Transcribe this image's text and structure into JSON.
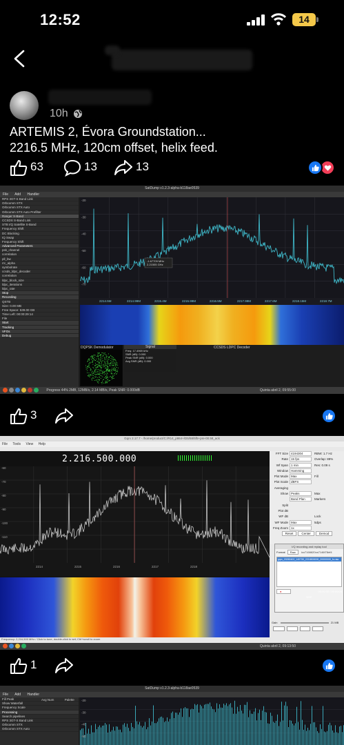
{
  "status_bar": {
    "time": "12:52",
    "battery": "14"
  },
  "post": {
    "time": "10h",
    "caption_line1": "ARTEMIS 2, Évora Groundstation...",
    "caption_line2": "2216.5 MHz, 120cm offset, helix feed.",
    "likes": "63",
    "comments": "13",
    "shares": "13"
  },
  "screenshot1": {
    "window_title": "SatDump v1.2.3-alpha-b118ae0539",
    "menu": [
      "File",
      "Add",
      "Handler"
    ],
    "sidebar": [
      "RPS 3GT-S Band Link",
      "Orbcomm STX",
      "Orbcomm STX Auto",
      "Orbcomm STX Auto Prefilter",
      "Ranger X-Band",
      "CCSDS S-Band Link",
      "STB I/Q Satellite S-Band",
      "Frequency Shift",
      "DC Blocking",
      "IQ Swap",
      "Frequency Shift",
      "Advanced Parameters",
      "psk_channel",
      "correlation",
      "pll_bw",
      "rrc_alpha",
      "symbolrate",
      "ccsds_ldpc_decoder",
      "correlation",
      "ldpc_block_size",
      "ldpc_iterations",
      "ldpc_rate",
      "Stop",
      "Recording",
      "QSTB",
      "Size: 0.00 MB",
      "Free Space: 539.00 GB",
      "Time Left: 00:00:29:14",
      "File",
      "Start",
      "Tracking",
      "VFOs",
      "Debug"
    ],
    "freq_ticks": [
      "2214.5M",
      "2214.99M",
      "2215.4M",
      "2215.99M",
      "2216.5M",
      "2217.99M",
      "2217.6M",
      "2218.15M",
      "2218.7M"
    ],
    "y_ticks": [
      "-20",
      "-30",
      "-40",
      "-50",
      "-60",
      "-70"
    ],
    "marker": "-1.67709 MHz\n2.21505 GHz",
    "demod_title": "DQPSK Demodulator",
    "signal_title": "Signal",
    "signal_freq": "Freq: 17.4969 kHz",
    "snr": "SNR (dB): 0.000",
    "peak_snr": "Peak SNR (dB): 0.000",
    "avg_snr": "Avg SNR (dB): 0.000",
    "decoder_title": "CCSDS LDPC Decoder",
    "taskbar_text": "Progress 44% 2MB, 12MB/s, 2.14 MB/s, Peak SNR: 0.000dB",
    "clock": "Quinta abril 2, 09:55:00"
  },
  "post1_actions": {
    "likes": "3"
  },
  "screenshot2": {
    "window_title": "Gqrx 2.17.7 - /home/product/C:/R14_p864+/D5/58/5f5+pre-00.58_ack",
    "menu": [
      "File",
      "Tools",
      "View",
      "Help"
    ],
    "frequency_display": "2.216.500.000",
    "y_ticks": [
      "-60",
      "-70",
      "-80",
      "-90",
      "-100",
      "-110",
      "-120"
    ],
    "freq_ticks": [
      "2214",
      "2215",
      "2216",
      "2217",
      "2218"
    ],
    "fft_panel": {
      "rows": [
        [
          "FFT Size",
          "4194304",
          "RBW: 1.7 Hz"
        ],
        [
          "Rate",
          "15 fps",
          "Overlap: 89%"
        ],
        [
          "Wf Span",
          "1 min",
          "Res: 0.09 s"
        ],
        [
          "Window",
          "Hamming",
          ""
        ],
        [
          "Plot Mode",
          "Max",
          "Fill"
        ],
        [
          "Plot Scale",
          "dBFS",
          ""
        ],
        [
          "Averaging",
          "",
          ""
        ],
        [
          "Show",
          "Peaks",
          "Max"
        ],
        [
          "",
          "Band Plan",
          "Markers"
        ],
        [
          "Split",
          "",
          ""
        ],
        [
          "Plot dB",
          "",
          ""
        ],
        [
          "WF dB",
          "",
          "Lock"
        ],
        [
          "WF Mode",
          "Max",
          "5dps"
        ],
        [
          "Freq Zoom",
          "1x",
          ""
        ]
      ],
      "buttons": [
        "Reset",
        "Center",
        "Demod"
      ]
    },
    "recording_dialog": {
      "title": "I/Q recording and replay tool",
      "format_label": "Format",
      "format_value": "Raw",
      "file_value": "ico7166620cs7146f78ef4",
      "selected_file": "gqrx_20260402_140730_2216500000_20000000_fc.raw",
      "rec_label": "Rec",
      "time": "00:00:00 / 00:00:00",
      "size": "21 MB",
      "dsp_label": "DSP"
    },
    "bottom_buttons": [
      "Mute",
      "LSB",
      "Rec",
      "Play"
    ],
    "gain_label": "Gain",
    "status": "Frequency: 2,216,500 MHz / Click to tune, double-click to set; Ctrl+scroll to zoom",
    "clock": "Quinta abril 2, 09:13:50"
  },
  "post2_actions": {
    "likes": "1"
  },
  "screenshot3": {
    "window_title": "SatDump v1.2.3-alpha-b118ae0539",
    "menu": [
      "File",
      "Add",
      "Handler"
    ],
    "sidebar": [
      "Fill Peak",
      "Show Waterfall",
      "Frequency Scale",
      "Processing",
      "Search pipelines",
      "RPS 3GT-S Band Link",
      "Orbcomm STX",
      "Orbcomm STX Auto"
    ],
    "options": [
      "Avg Num",
      "Palette"
    ],
    "y_ticks": [
      "-20",
      "-30",
      "-40",
      "-50"
    ]
  }
}
